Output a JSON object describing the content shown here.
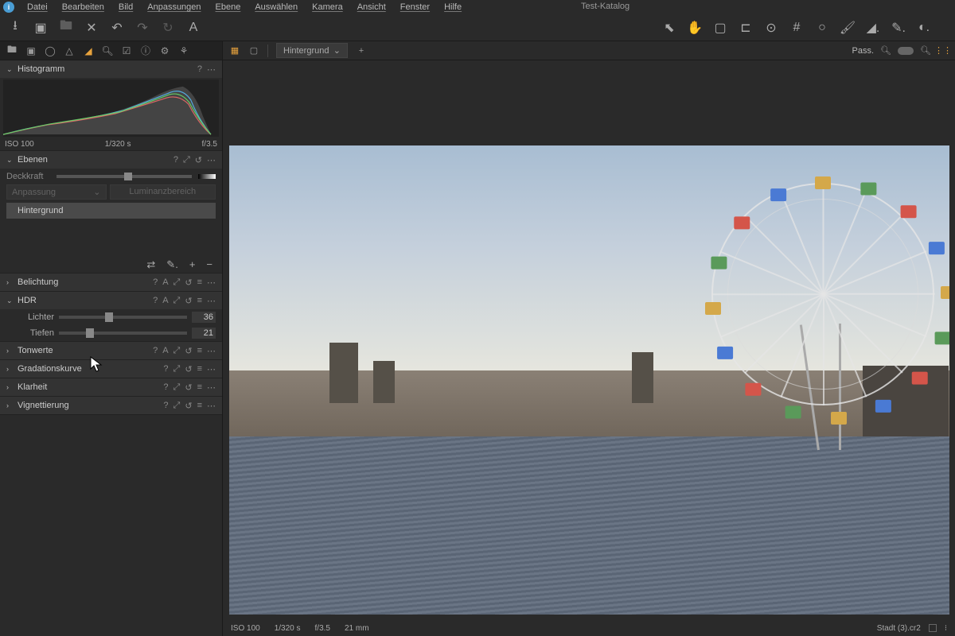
{
  "app": {
    "catalog_title": "Test-Katalog"
  },
  "menu": {
    "items": [
      "Datei",
      "Bearbeiten",
      "Bild",
      "Anpassungen",
      "Ebene",
      "Auswählen",
      "Kamera",
      "Ansicht",
      "Fenster",
      "Hilfe"
    ]
  },
  "view_toolbar": {
    "layer_selector": "Hintergrund",
    "pass_label": "Pass."
  },
  "histogram": {
    "title": "Histogramm",
    "iso": "ISO 100",
    "shutter": "1/320 s",
    "aperture": "f/3.5"
  },
  "layers": {
    "title": "Ebenen",
    "opacity_label": "Deckkraft",
    "adjustment_label": "Anpassung",
    "luminance_btn": "Luminanzbereich",
    "background_layer": "Hintergrund"
  },
  "panels": {
    "exposure": "Belichtung",
    "hdr": "HDR",
    "tonwerte": "Tonwerte",
    "gradation": "Gradationskurve",
    "klarheit": "Klarheit",
    "vignette": "Vignettierung"
  },
  "hdr": {
    "highlights_label": "Lichter",
    "highlights_value": "36",
    "shadows_label": "Tiefen",
    "shadows_value": "21"
  },
  "statusbar": {
    "iso": "ISO 100",
    "shutter": "1/320 s",
    "aperture": "f/3.5",
    "focal": "21 mm",
    "filename": "Stadt (3).cr2"
  }
}
